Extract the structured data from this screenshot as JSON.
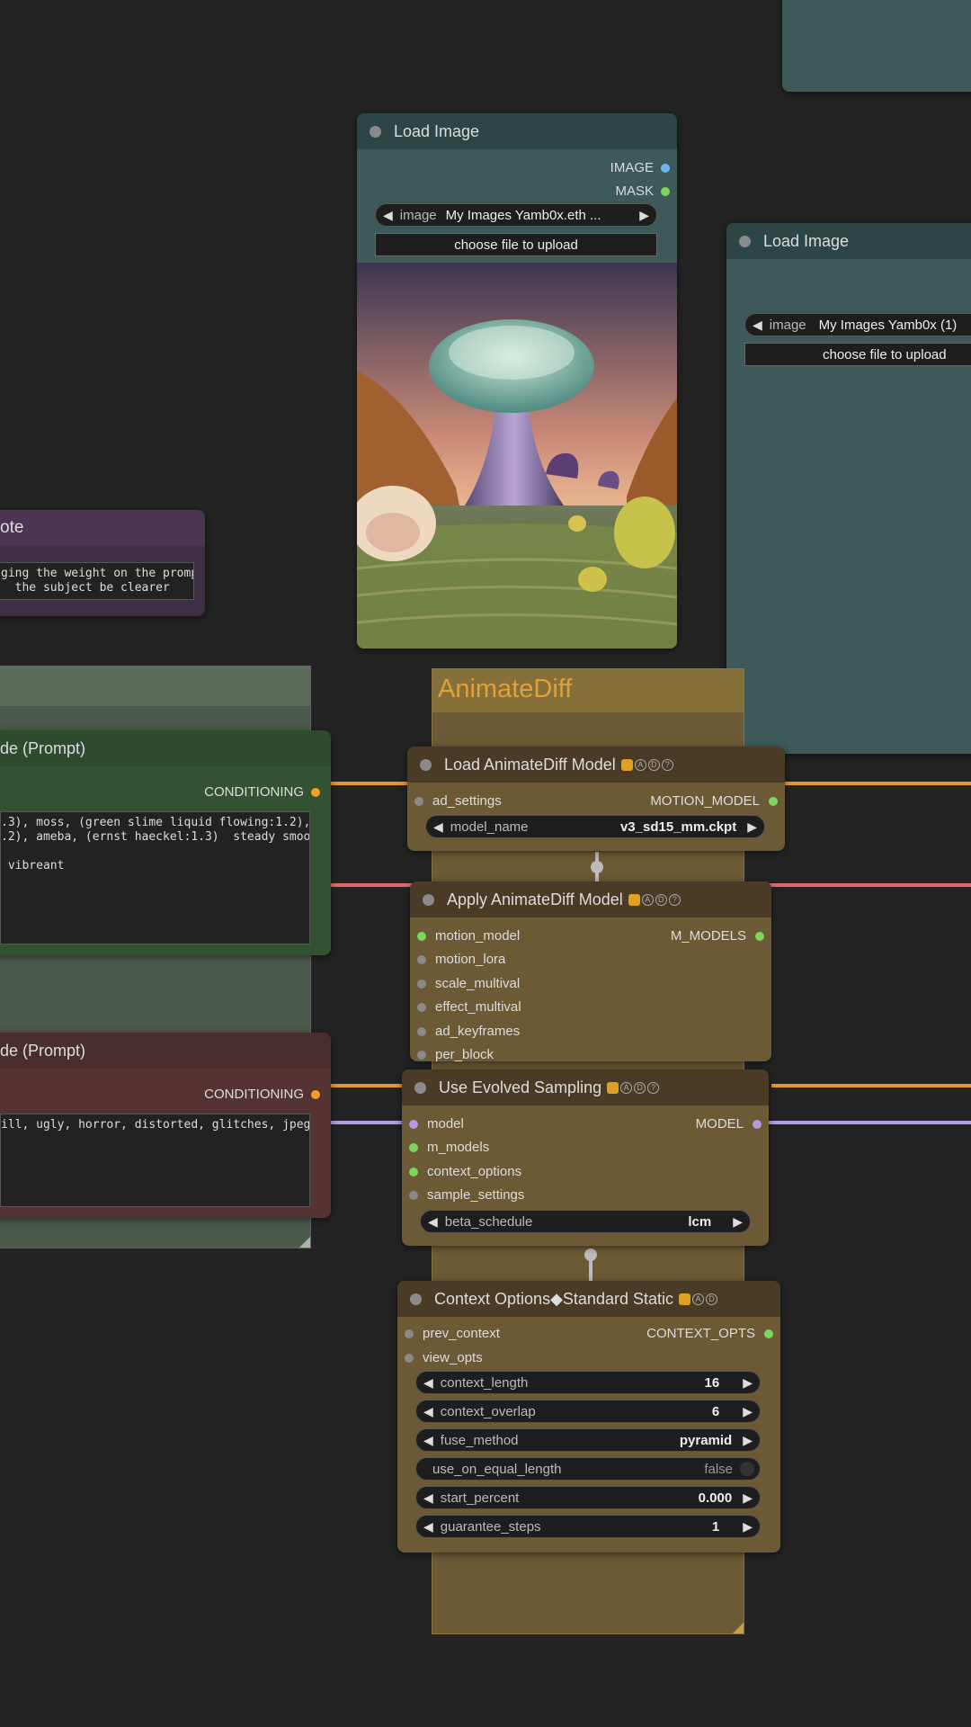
{
  "colors": {
    "bg": "#232323",
    "wire_conditioning": "#e39a2b",
    "wire_pink": "#e06a6a",
    "wire_model": "#b59be0",
    "slot_green": "#7bd65a",
    "slot_blue": "#6cb6ee",
    "slot_orange": "#f0a020",
    "slot_purple": "#b59be0"
  },
  "note": {
    "title": "ote",
    "text": "ging the weight on the prompt\n  the subject be clearer"
  },
  "positive_prompt": {
    "title": "de (Prompt)",
    "output": "CONDITIONING",
    "text": ".3), moss, (green slime liquid flowing:1.2),\n.2), ameba, (ernst haeckel:1.3)  steady smooth\n\n vibreant"
  },
  "negative_prompt": {
    "title": "de (Prompt)",
    "output": "CONDITIONING",
    "text": "ill, ugly, horror, distorted, glitches, jpeg,"
  },
  "load_image_1": {
    "title": "Load Image",
    "outputs": [
      "IMAGE",
      "MASK"
    ],
    "widget_label": "image",
    "widget_value": "My Images Yamb0x.eth ...",
    "upload_label": "choose file to upload"
  },
  "load_image_2": {
    "title": "Load Image",
    "widget_label": "image",
    "widget_value": "My Images Yamb0x (1)",
    "upload_label": "choose file to upload"
  },
  "group": {
    "title": "AnimateDiff"
  },
  "load_animatediff": {
    "title": "Load AnimateDiff Model",
    "badges": [
      "A",
      "D",
      "?"
    ],
    "input": "ad_settings",
    "output": "MOTION_MODEL",
    "widget_label": "model_name",
    "widget_value": "v3_sd15_mm.ckpt"
  },
  "apply_animatediff": {
    "title": "Apply AnimateDiff Model",
    "badges": [
      "A",
      "D",
      "?"
    ],
    "inputs": [
      "motion_model",
      "motion_lora",
      "scale_multival",
      "effect_multival",
      "ad_keyframes",
      "per_block"
    ],
    "output": "M_MODELS"
  },
  "evolved_sampling": {
    "title": "Use Evolved Sampling",
    "badges": [
      "A",
      "D",
      "?"
    ],
    "inputs": [
      "model",
      "m_models",
      "context_options",
      "sample_settings"
    ],
    "output": "MODEL",
    "widget_label": "beta_schedule",
    "widget_value": "lcm"
  },
  "context_options": {
    "title": "Context Options◆Standard Static",
    "badges": [
      "A",
      "D"
    ],
    "inputs": [
      "prev_context",
      "view_opts"
    ],
    "output": "CONTEXT_OPTS",
    "widgets": [
      {
        "label": "context_length",
        "value": "16"
      },
      {
        "label": "context_overlap",
        "value": "6"
      },
      {
        "label": "fuse_method",
        "value": "pyramid"
      },
      {
        "label": "use_on_equal_length",
        "value": "false"
      },
      {
        "label": "start_percent",
        "value": "0.000"
      },
      {
        "label": "guarantee_steps",
        "value": "1"
      }
    ]
  }
}
